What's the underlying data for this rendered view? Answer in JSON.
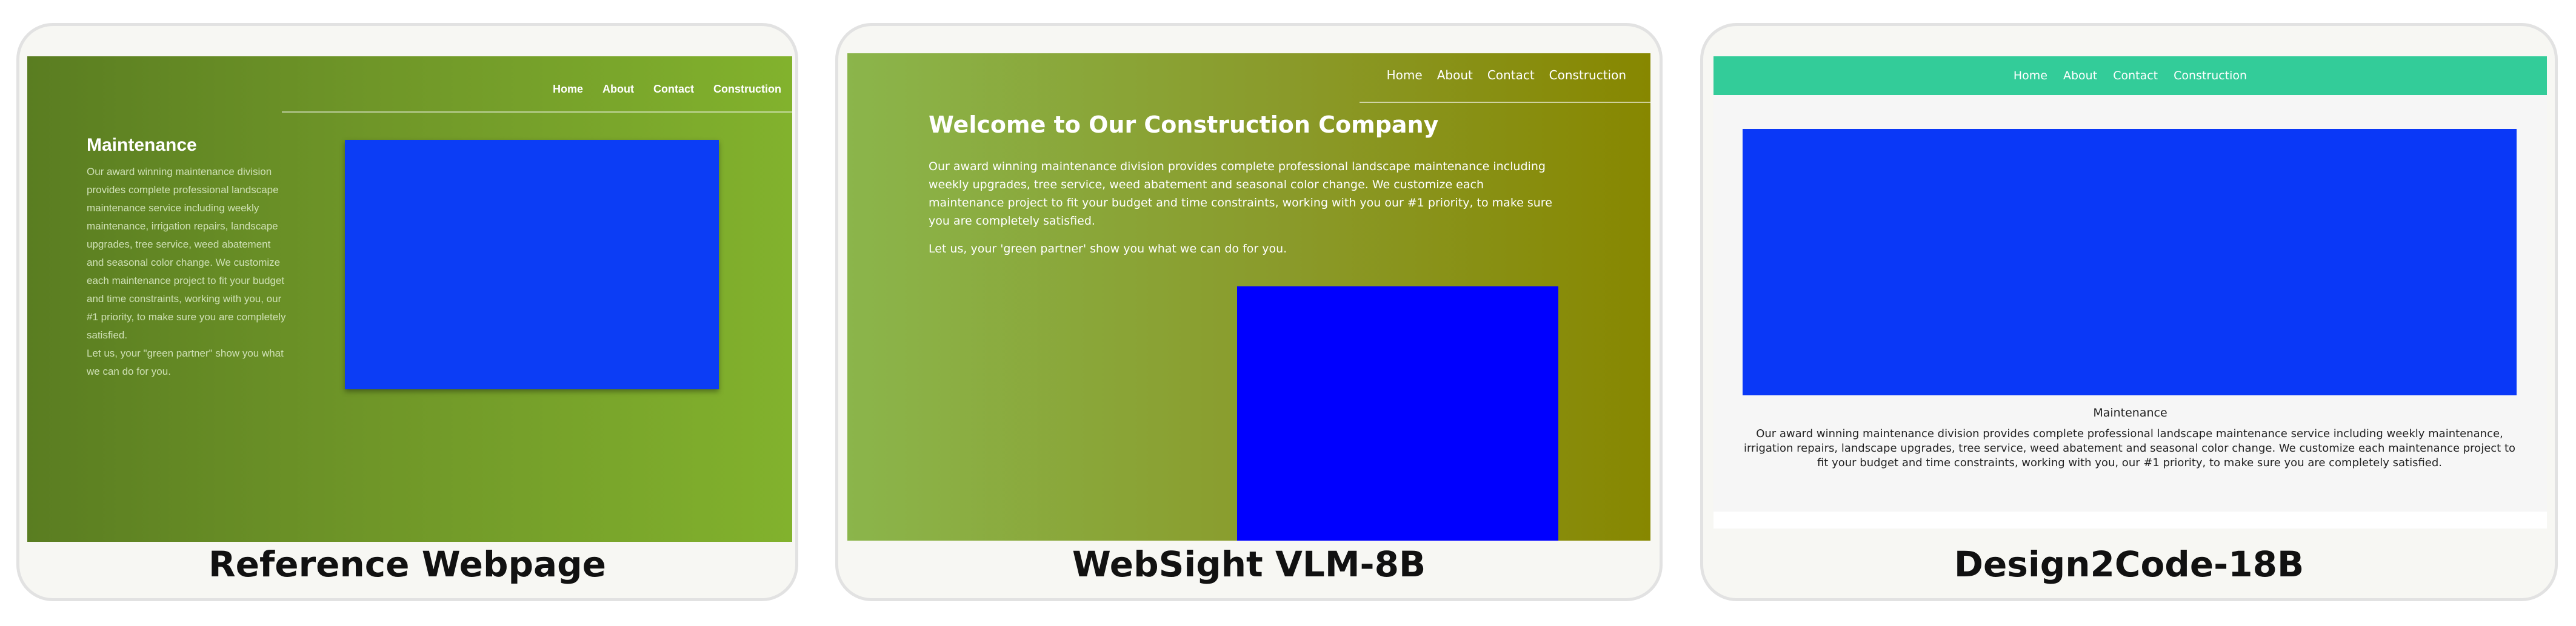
{
  "reference": {
    "nav": [
      "Home",
      "About",
      "Contact",
      "Construction"
    ],
    "title": "Maintenance",
    "paragraph1": "Our award winning maintenance division provides complete professional landscape maintenance service including weekly maintenance, irrigation repairs, landscape upgrades, tree service, weed abatement and seasonal color change. We customize each maintenance project to fit your budget and time constraints, working with you, our #1 priority, to make sure you are completely satisfied.",
    "paragraph2": "Let us, your \"green partner\" show you what we can do for you.",
    "caption": "Reference Webpage"
  },
  "websight": {
    "nav": [
      "Home",
      "About",
      "Contact",
      "Construction"
    ],
    "title": "Welcome to Our Construction Company",
    "paragraph1": "Our award winning maintenance division provides complete professional landscape maintenance including weekly upgrades, tree service, weed abatement and seasonal color change. We customize each maintenance project to fit your budget and time constraints, working with you our #1 priority, to make sure you are completely satisfied.",
    "paragraph2": "Let us, your 'green partner' show you what we can do for you.",
    "caption": "WebSight  VLM-8B"
  },
  "design2code": {
    "nav": [
      "Home",
      "About",
      "Contact",
      "Construction"
    ],
    "title": "Maintenance",
    "paragraph1": "Our award winning maintenance division provides complete professional landscape maintenance service including weekly maintenance, irrigation repairs, landscape upgrades, tree service, weed abatement and seasonal color change. We customize each maintenance project to fit your budget and time constraints, working with you, our #1 priority, to make sure you are completely satisfied.",
    "caption": "Design2Code-18B"
  },
  "colors": {
    "ref_image": "#0c3df5",
    "ws_image": "#0000ff",
    "d2c_image": "#0a38f7",
    "d2c_nav": "#33cc99"
  }
}
